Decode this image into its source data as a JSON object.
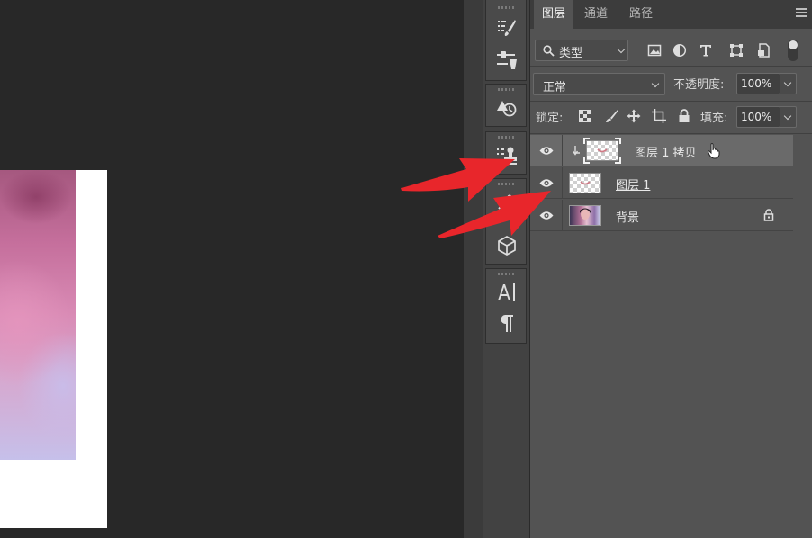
{
  "layers_panel": {
    "tabs": [
      {
        "label": "图层",
        "active": true
      },
      {
        "label": "通道",
        "active": false
      },
      {
        "label": "路径",
        "active": false
      }
    ],
    "filter": {
      "label": "类型"
    },
    "filter_icons": [
      "image-filter-icon",
      "adjustment-filter-icon",
      "type-filter-icon",
      "shape-filter-icon",
      "smart-object-filter-icon"
    ],
    "blend_mode": "正常",
    "opacity_label": "不透明度:",
    "opacity_value": "100%",
    "lock_label": "锁定:",
    "lock_icons": [
      "lock-transparent-icon",
      "lock-pixels-icon",
      "lock-position-icon",
      "lock-artboard-icon",
      "lock-all-icon"
    ],
    "fill_label": "填充:",
    "fill_value": "100%",
    "layers": [
      {
        "name": "图层 1 拷贝",
        "selected": true,
        "visible": true,
        "clipped": true,
        "thumb": "transparent-with-mark"
      },
      {
        "name": "图层 1",
        "selected": false,
        "visible": true,
        "clipped": false,
        "thumb": "transparent-with-mark"
      },
      {
        "name": "背景",
        "selected": false,
        "visible": true,
        "locked": true,
        "thumb": "photo"
      }
    ]
  },
  "colors": {
    "canvas_bg": "#282828",
    "panel_bg": "#535353",
    "selected_row": "#6a6a6a",
    "arrow": "#e8262b"
  }
}
